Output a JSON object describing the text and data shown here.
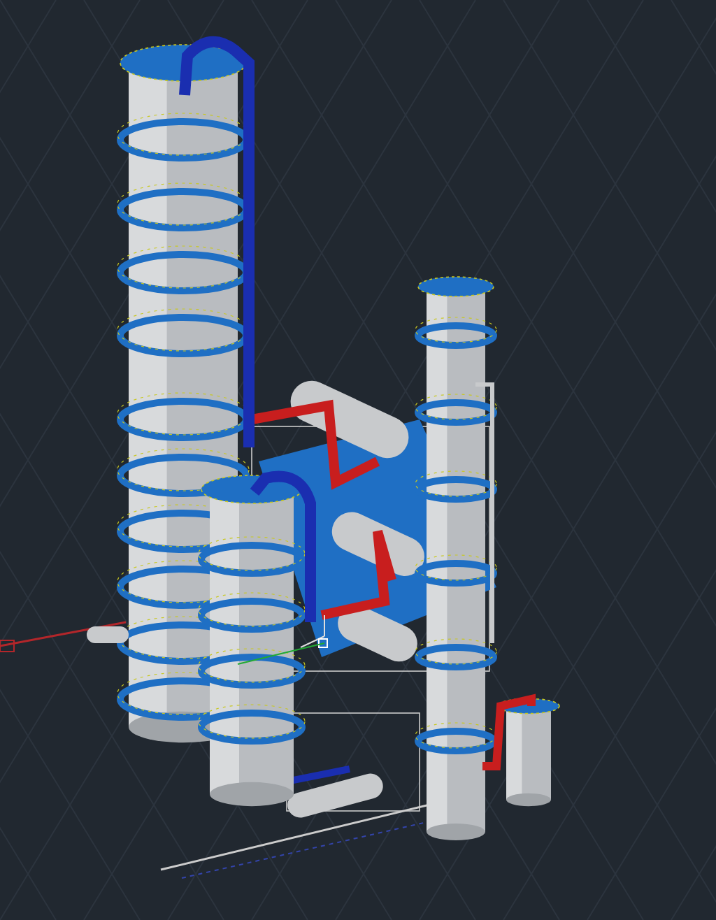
{
  "viewport": {
    "kind": "model"
  }
}
